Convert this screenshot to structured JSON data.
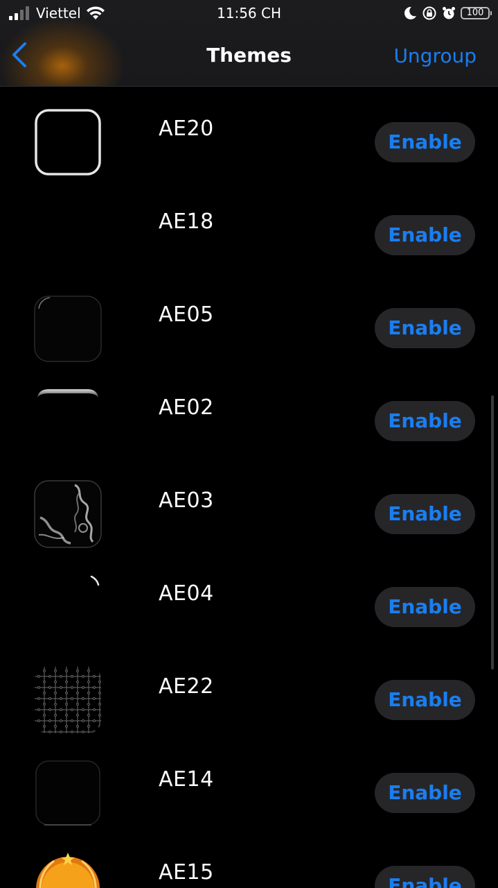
{
  "status_bar": {
    "carrier": "Viettel",
    "time": "11:56 CH",
    "battery": "100"
  },
  "nav": {
    "title": "Themes",
    "right_button": "Ungroup"
  },
  "colors": {
    "accent": "#1a7ef0",
    "background": "#000000",
    "button_bg": "#262629"
  },
  "themes": [
    {
      "name": "AE20",
      "button": "Enable",
      "thumbnail": "white-rounded-square-outline"
    },
    {
      "name": "AE18",
      "button": "Enable",
      "thumbnail": "blank"
    },
    {
      "name": "AE05",
      "button": "Enable",
      "thumbnail": "dark-rounded-square"
    },
    {
      "name": "AE02",
      "button": "Enable",
      "thumbnail": "top-bevel"
    },
    {
      "name": "AE03",
      "button": "Enable",
      "thumbnail": "smoke-frame"
    },
    {
      "name": "AE04",
      "button": "Enable",
      "thumbnail": "corner-glint"
    },
    {
      "name": "AE22",
      "button": "Enable",
      "thumbnail": "puzzle-pattern"
    },
    {
      "name": "AE14",
      "button": "Enable",
      "thumbnail": "dark-shade-square"
    },
    {
      "name": "AE15",
      "button": "Enable",
      "thumbnail": "orange-laurel-badge"
    }
  ]
}
